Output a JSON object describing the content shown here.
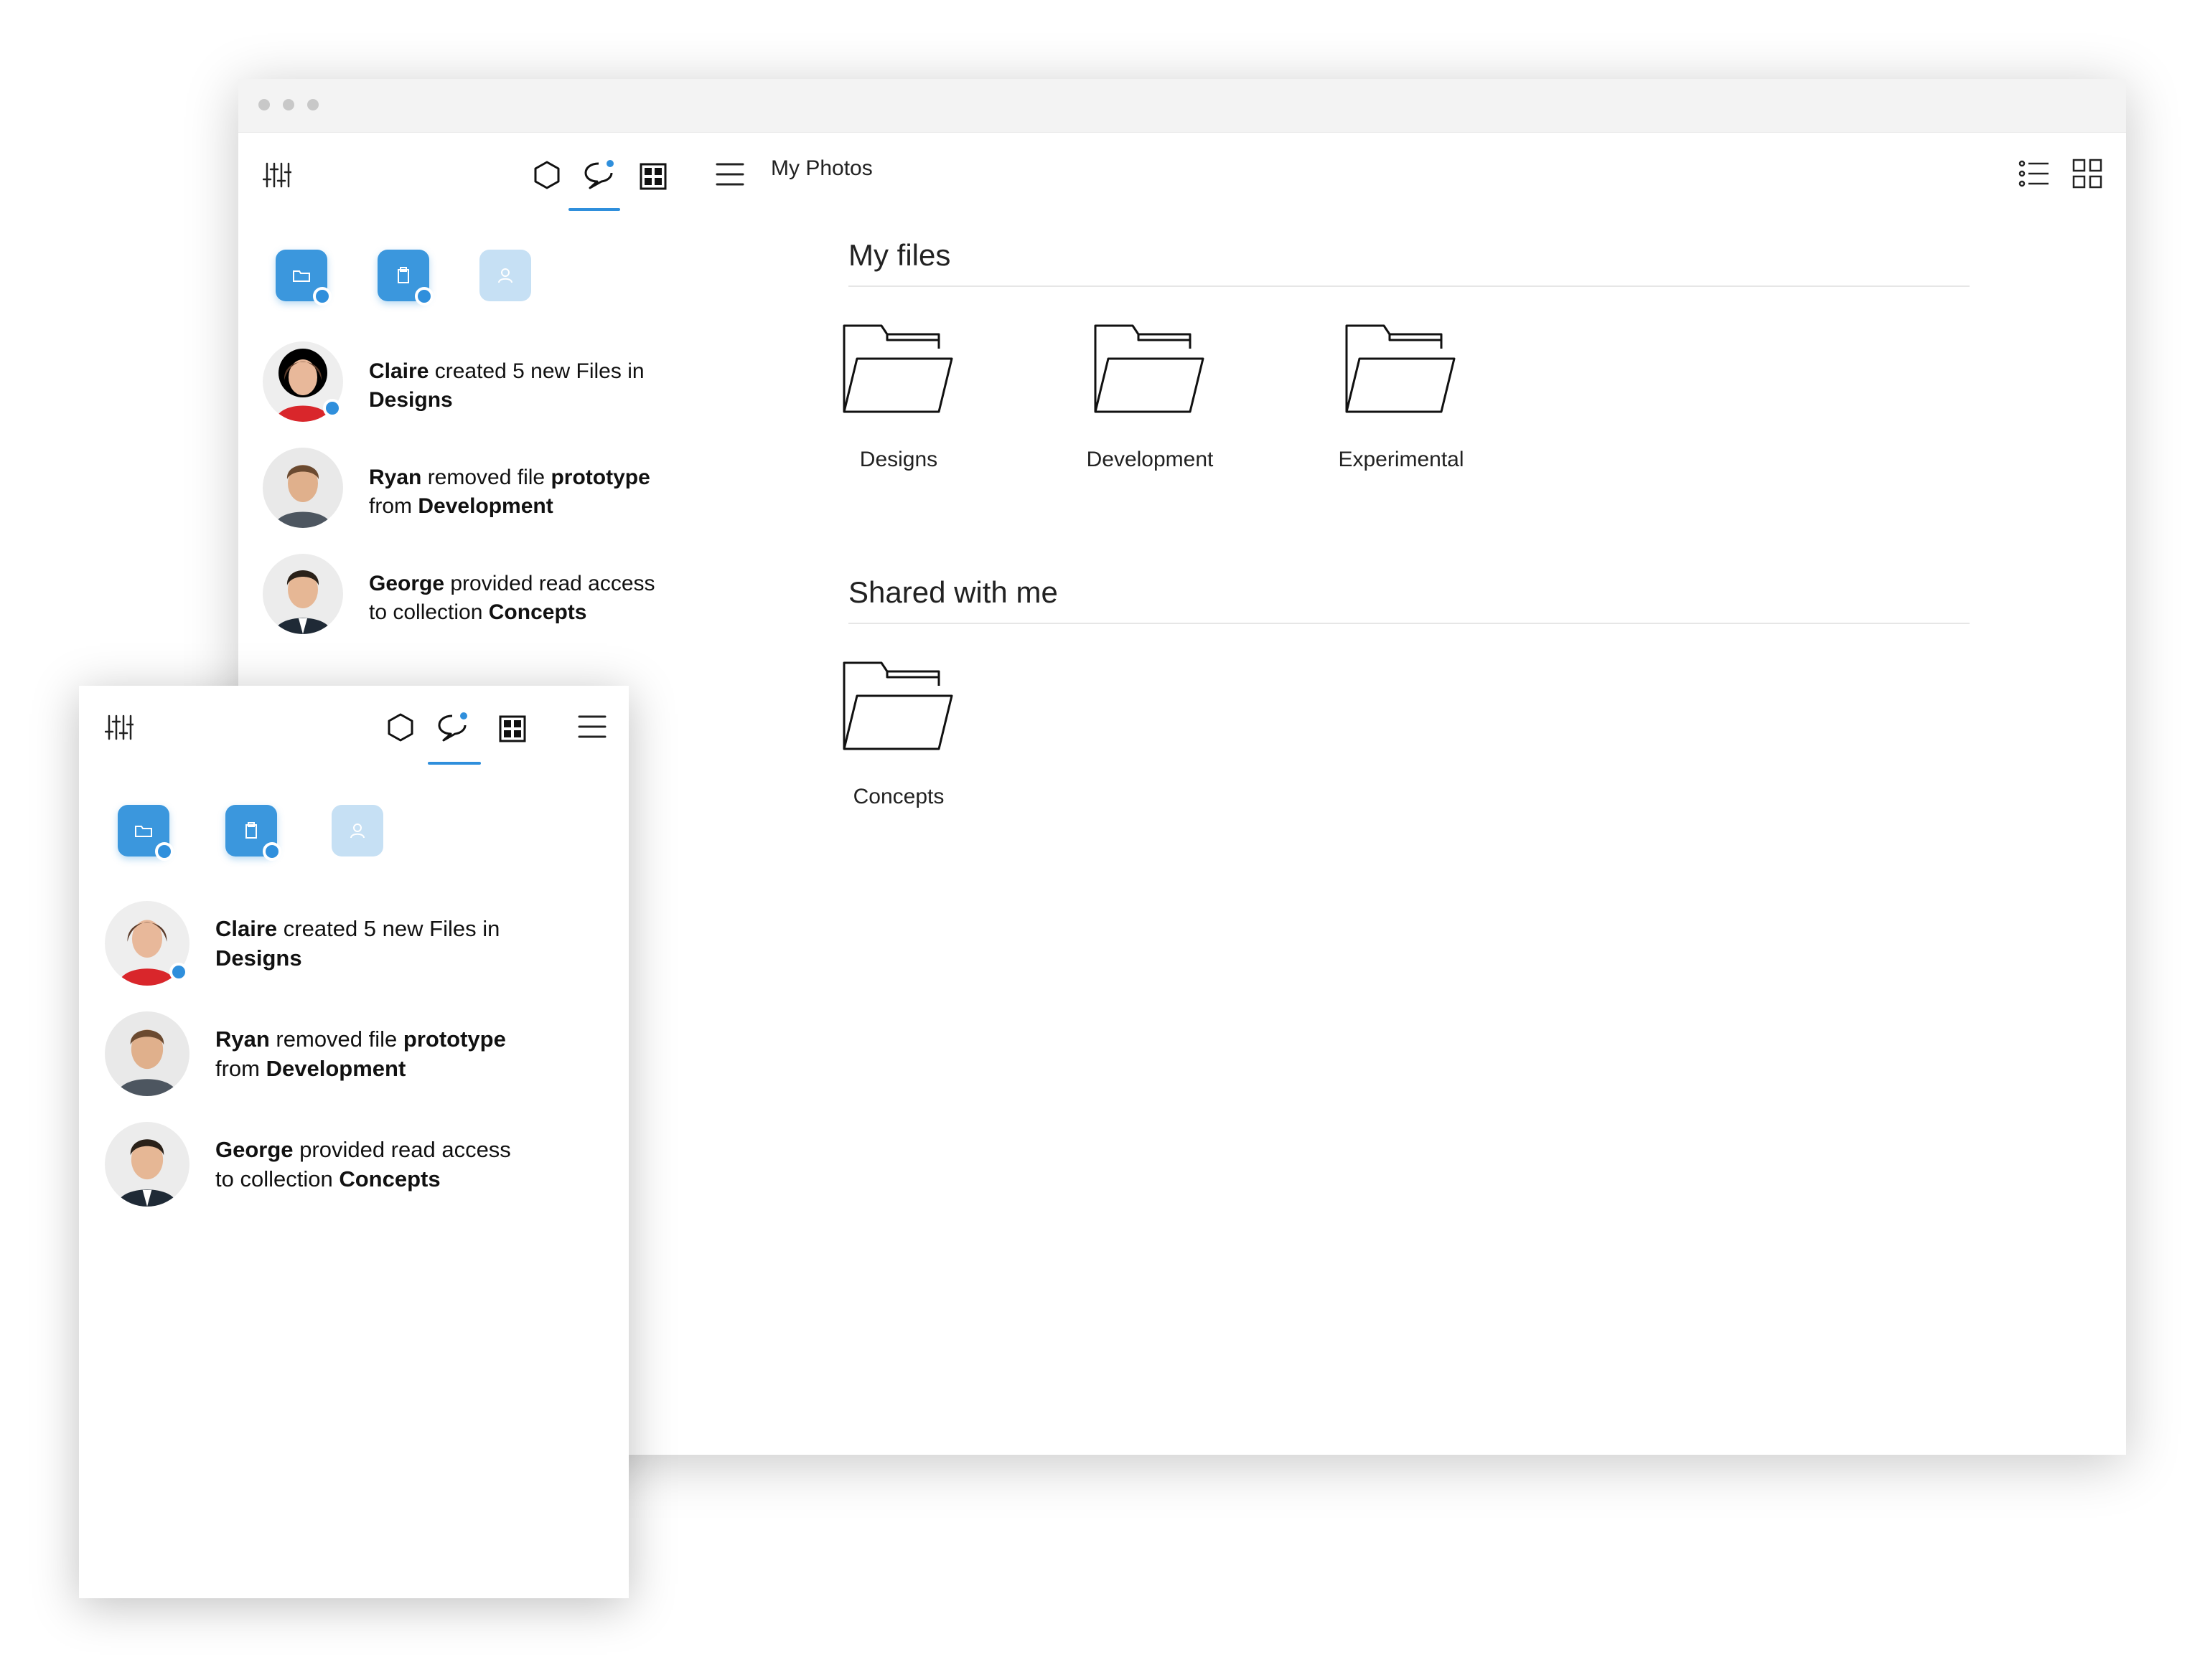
{
  "window": {
    "title": "My Photos",
    "sidebar_activity": [
      {
        "user": "Claire",
        "action_pre": " created 5 new Files in",
        "line2_pre": "",
        "line2_bold": "Designs",
        "bold_after": "",
        "online": true,
        "avatar_colors": {
          "shirt": "#d9262b",
          "hair": "#5b3b2a",
          "skin": "#e8b89a"
        }
      },
      {
        "user": "Ryan",
        "action_pre": " removed file ",
        "bold_after": "prototype",
        "line2_pre": "from ",
        "line2_bold": "Development",
        "online": false,
        "avatar_colors": {
          "shirt": "#4d5660",
          "hair": "#6b4a30",
          "skin": "#e0b08c"
        }
      },
      {
        "user": "George",
        "action_pre": " provided read access",
        "bold_after": "",
        "line2_pre": "to collection ",
        "line2_bold": "Concepts",
        "online": false,
        "avatar_colors": {
          "shirt": "#1f2a36",
          "hair": "#2a2119",
          "skin": "#e6b795"
        }
      }
    ]
  },
  "main": {
    "my_files_title": "My files",
    "my_files": [
      "Designs",
      "Development",
      "Experimental"
    ],
    "shared_title": "Shared with me",
    "shared": [
      "Concepts"
    ]
  },
  "colors": {
    "accent": "#2f8fdc",
    "quick_active": "#3b97dd",
    "quick_faded": "#c6e0f4"
  },
  "icons": [
    "settings-sliders-icon",
    "hexagon-icon",
    "chat-bubble-icon",
    "grid-app-icon",
    "hamburger-menu-icon",
    "list-view-icon",
    "grid-view-icon",
    "folder-icon",
    "clipboard-icon",
    "users-icon"
  ]
}
